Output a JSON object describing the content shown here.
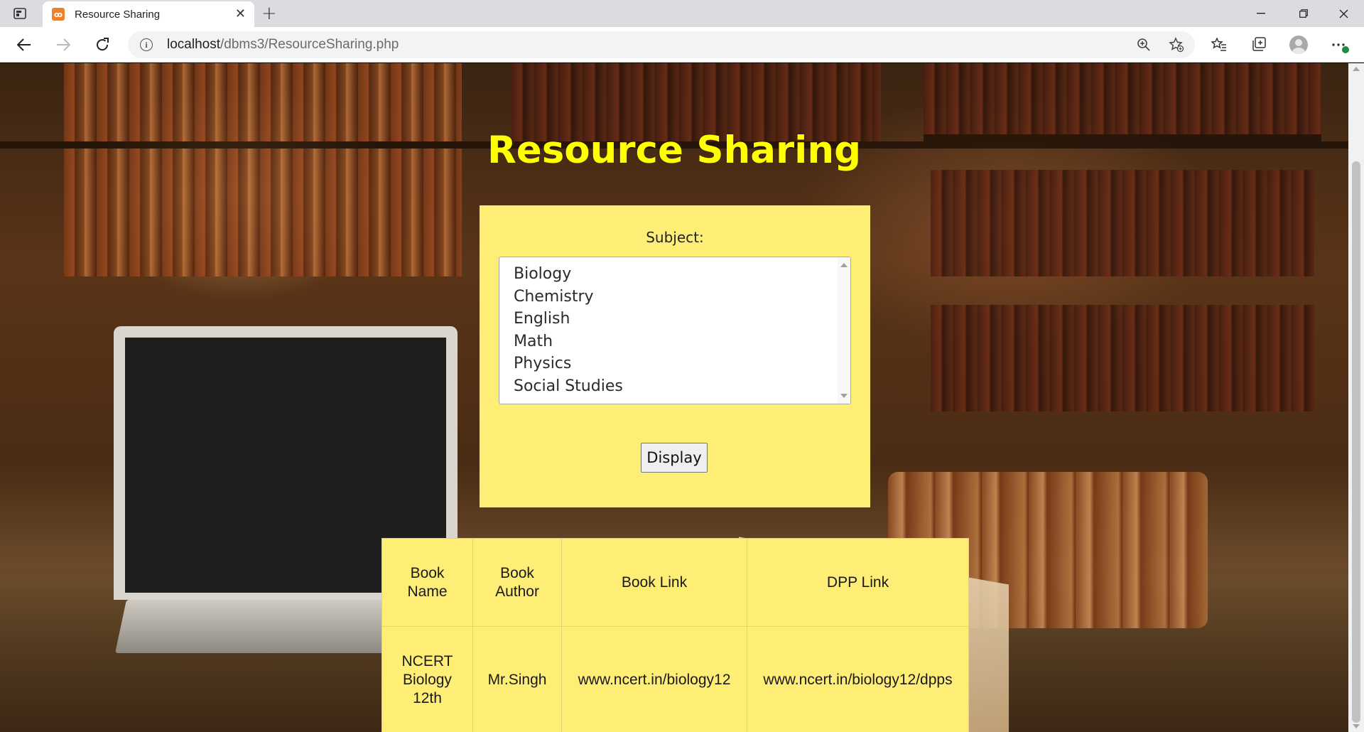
{
  "browser": {
    "tab_title": "Resource Sharing",
    "url_host": "localhost",
    "url_path": "/dbms3/ResourceSharing.php",
    "icons": [
      "tab-actions-icon",
      "xampp-favicon-icon",
      "close-icon",
      "plus-icon",
      "minimize-icon",
      "restore-icon",
      "close-window-icon",
      "back-icon",
      "forward-icon",
      "reload-icon",
      "info-icon",
      "zoom-icon",
      "favorites-add-icon",
      "favorites-icon",
      "collections-icon",
      "profile-icon",
      "more-icon"
    ]
  },
  "page": {
    "title": "Resource Sharing",
    "subject_label": "Subject:",
    "subjects": [
      "Biology",
      "Chemistry",
      "English",
      "Math",
      "Physics",
      "Social Studies"
    ],
    "display_button": "Display",
    "table": {
      "headers": [
        "Book Name",
        "Book Author",
        "Book Link",
        "DPP Link"
      ],
      "rows": [
        [
          "NCERT Biology 12th",
          "Mr.Singh",
          "www.ncert.in/biology12",
          "www.ncert.in/biology12/dpps"
        ]
      ]
    },
    "colors": {
      "title": "#ffff00",
      "panel": "#ffee75"
    }
  }
}
